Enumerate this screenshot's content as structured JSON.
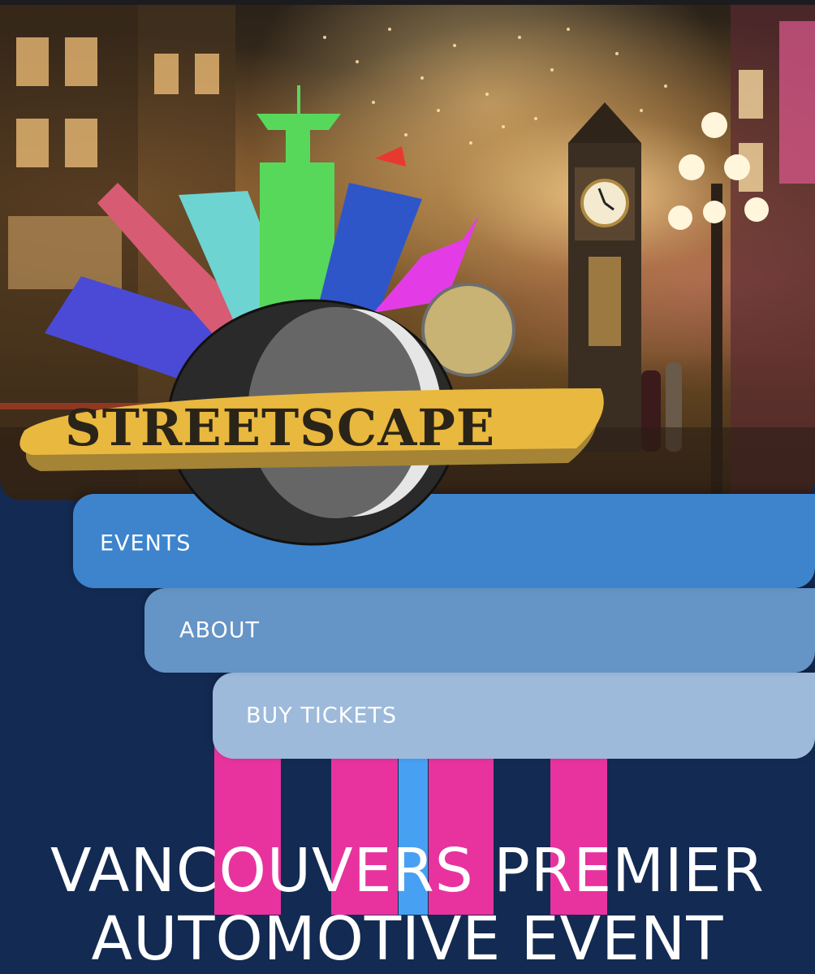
{
  "hero": {
    "image_alt": "Gastown steam clock street at night",
    "logo_text": "STREETSCAPE"
  },
  "nav": {
    "items": [
      {
        "label": "EVENTS"
      },
      {
        "label": "ABOUT"
      },
      {
        "label": "BUY TICKETS"
      }
    ]
  },
  "main": {
    "headline_line1": "VANCOUVERS PREMIER",
    "headline_line2": "AUTOMOTIVE EVENT"
  },
  "colors": {
    "background": "#132a52",
    "tab_events": "#3d84cd",
    "tab_about": "#6594c6",
    "tab_buy": "#9dbadb",
    "stripe_pink": "#e8339e",
    "stripe_blue": "#48a0f3",
    "logo_banner": "#e9b83f"
  }
}
